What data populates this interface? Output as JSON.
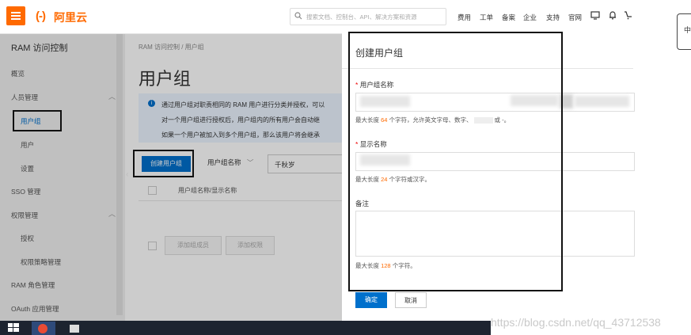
{
  "header": {
    "menu_icon": "hamburger-menu-icon",
    "logo_mark": "(-)",
    "logo_text": "阿里云",
    "search_placeholder": "搜索文档、控制台、API、解决方案和资源",
    "nav": [
      "费用",
      "工单",
      "备案",
      "企业",
      "支持",
      "官网"
    ],
    "icons": [
      "screen-icon",
      "bell-icon",
      "cart-icon"
    ],
    "accent_color": "#ff6a00"
  },
  "sidebar": {
    "title": "RAM 访问控制",
    "items": [
      {
        "label": "概览"
      },
      {
        "label": "人员管理"
      },
      {
        "label": "用户组"
      },
      {
        "label": "用户"
      },
      {
        "label": "设置"
      },
      {
        "label": "SSO 管理"
      },
      {
        "label": "权限管理"
      },
      {
        "label": "授权"
      },
      {
        "label": "权限策略管理"
      },
      {
        "label": "RAM 角色管理"
      },
      {
        "label": "OAuth 应用管理"
      }
    ]
  },
  "main": {
    "breadcrumb": "RAM 访问控制 / 用户组",
    "title": "用户组",
    "info_lines": [
      "通过用户组对职责相同的 RAM 用户进行分类并授权，可以",
      "对一个用户组进行授权后，用户组内的所有用户会自动继",
      "如果一个用户被加入到多个用户组，那么该用户将会继承"
    ],
    "create_button": "创建用户组",
    "filter_select": "用户组名称",
    "filter_value": "千秋岁",
    "column_header": "用户组名称/显示名称",
    "add_member_button": "添加组成员",
    "add_permission_button": "添加权限"
  },
  "drawer": {
    "title": "创建用户组",
    "group_name_label": "用户组名称",
    "group_name_hint_pre": "最大长度 ",
    "group_name_max": "64",
    "group_name_hint_post": " 个字符，允许英文字母、数字、",
    "group_name_hint_tail": "或 -。",
    "display_name_label": "显示名称",
    "display_name_hint_pre": "最大长度 ",
    "display_name_max": "24",
    "display_name_hint_post": " 个字符或汉字。",
    "remark_label": "备注",
    "remark_hint_pre": "最大长度 ",
    "remark_max": "128",
    "remark_hint_post": " 个字符。",
    "confirm": "确定",
    "cancel": "取消",
    "required_mark": "*"
  },
  "right_tab": "中",
  "watermark": "https://blog.csdn.net/qq_43712538"
}
